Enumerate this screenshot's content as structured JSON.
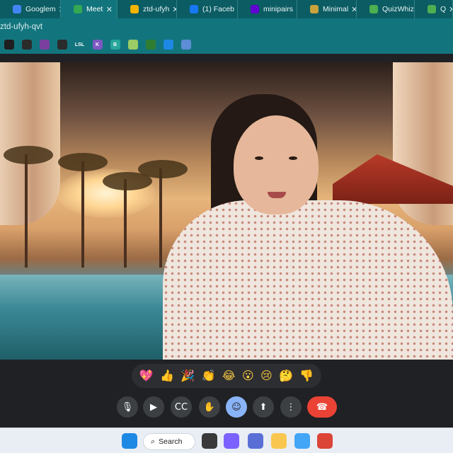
{
  "browser": {
    "tabs": [
      {
        "label": "Googlem",
        "icon": "docs-icon",
        "color": "#4285f4",
        "active": false
      },
      {
        "label": "Meet",
        "icon": "meet-icon",
        "color": "#34a853",
        "active": true
      },
      {
        "label": "ztd-ufyh",
        "icon": "hand-icon",
        "color": "#f4b400",
        "active": false
      },
      {
        "label": "(1) Faceb",
        "icon": "facebook-icon",
        "color": "#1877f2",
        "active": false
      },
      {
        "label": "minipairs",
        "icon": "yahoo-icon",
        "color": "#6001d2",
        "active": false
      },
      {
        "label": "Minimal",
        "icon": "doc-icon",
        "color": "#c8a23a",
        "active": false
      },
      {
        "label": "QuizWhiz",
        "icon": "quizwhiz-icon",
        "color": "#4caf50",
        "active": false
      },
      {
        "label": "Q",
        "icon": "quizwhiz-icon",
        "color": "#4caf50",
        "active": false
      }
    ],
    "close_glyph": "✕",
    "url": "ztd-ufyh-qvt",
    "bookmarks": [
      {
        "icon": "wordpress-icon",
        "color": "#1f1f1f",
        "text": ""
      },
      {
        "icon": "globe-icon",
        "color": "#2b2b2b",
        "text": ""
      },
      {
        "icon": "stack-icon",
        "color": "#7b3fa0",
        "text": ""
      },
      {
        "icon": "globe-icon",
        "color": "#2b2b2b",
        "text": ""
      },
      {
        "icon": "lsl-icon",
        "color": "#12757d",
        "text": "LSL"
      },
      {
        "icon": "k-icon",
        "color": "#7e57c2",
        "text": "K"
      },
      {
        "icon": "b-icon",
        "color": "#26a69a",
        "text": "B"
      },
      {
        "icon": "sun-icon",
        "color": "#9ccc65",
        "text": ""
      },
      {
        "icon": "leaf-icon",
        "color": "#2e7d32",
        "text": ""
      },
      {
        "icon": "grid-icon",
        "color": "#1e88e5",
        "text": ""
      },
      {
        "icon": "puzzle-icon",
        "color": "#5c8dd6",
        "text": ""
      }
    ]
  },
  "meeting": {
    "reactions": [
      "💖",
      "👍",
      "🎉",
      "👏",
      "😂",
      "😮",
      "😢",
      "🤔",
      "👎"
    ],
    "controls": [
      {
        "name": "microphone-button",
        "glyph": "🎙",
        "highlight": false
      },
      {
        "name": "camera-button",
        "glyph": "▶",
        "highlight": false
      },
      {
        "name": "captions-button",
        "glyph": "CC",
        "highlight": false
      },
      {
        "name": "raise-hand-button",
        "glyph": "✋",
        "highlight": false
      },
      {
        "name": "reactions-button",
        "glyph": "☺",
        "highlight": true
      },
      {
        "name": "present-button",
        "glyph": "⬆",
        "highlight": false
      },
      {
        "name": "more-options-button",
        "glyph": "⋮",
        "highlight": false
      },
      {
        "name": "leave-call-button",
        "glyph": "☎",
        "highlight": false
      }
    ]
  },
  "taskbar": {
    "search_label": "Search",
    "search_glyph": "⌕",
    "apps": [
      {
        "name": "start-button",
        "icon": "windows-icon",
        "color": "#1e88e5"
      },
      {
        "name": "file-manager",
        "icon": "window-icon",
        "color": "#3a3a3a"
      },
      {
        "name": "chat-app",
        "icon": "chat-icon",
        "color": "#7b61ff"
      },
      {
        "name": "media-app",
        "icon": "bars-icon",
        "color": "#5a6fd6"
      },
      {
        "name": "file-explorer",
        "icon": "folder-icon",
        "color": "#f9c74f"
      },
      {
        "name": "messaging-app",
        "icon": "message-icon",
        "color": "#42a5f5"
      },
      {
        "name": "chrome-app",
        "icon": "chrome-icon",
        "color": "#db4437"
      }
    ]
  }
}
